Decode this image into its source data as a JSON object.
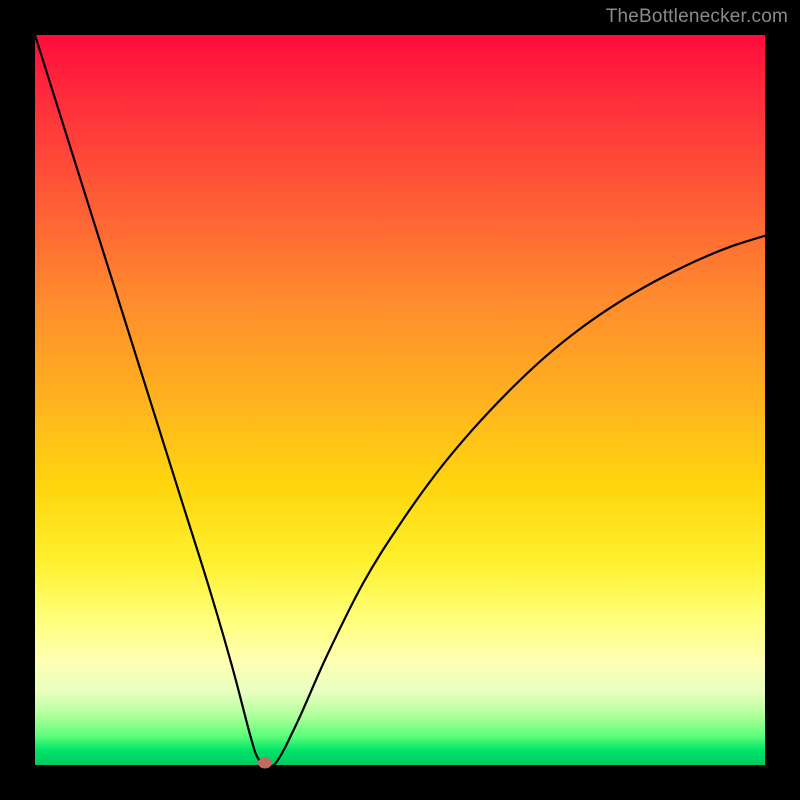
{
  "watermark": "TheBottlenecker.com",
  "chart_data": {
    "type": "line",
    "title": "",
    "xlabel": "",
    "ylabel": "",
    "xlim": [
      0,
      100
    ],
    "ylim": [
      0,
      100
    ],
    "x": [
      0,
      4,
      8,
      12,
      16,
      20,
      24,
      27,
      29.5,
      30.5,
      31.5,
      33,
      36,
      40,
      45,
      50,
      55,
      60,
      65,
      70,
      75,
      80,
      85,
      90,
      95,
      100
    ],
    "values": [
      100,
      87.3,
      74.6,
      61.9,
      49.2,
      36.5,
      23.8,
      13.5,
      4.0,
      1.0,
      0.3,
      0.3,
      6.0,
      15.0,
      25.0,
      33.0,
      40.0,
      46.0,
      51.3,
      56.0,
      60.0,
      63.4,
      66.3,
      68.8,
      70.9,
      72.5
    ],
    "min_marker": {
      "x": 31.5,
      "y": 0.3
    },
    "gradient_stops": [
      {
        "pos": 0.0,
        "color": "#ff0b3c"
      },
      {
        "pos": 0.5,
        "color": "#ffd60f"
      },
      {
        "pos": 0.85,
        "color": "#ffffb5"
      },
      {
        "pos": 1.0,
        "color": "#00c95f"
      }
    ]
  }
}
